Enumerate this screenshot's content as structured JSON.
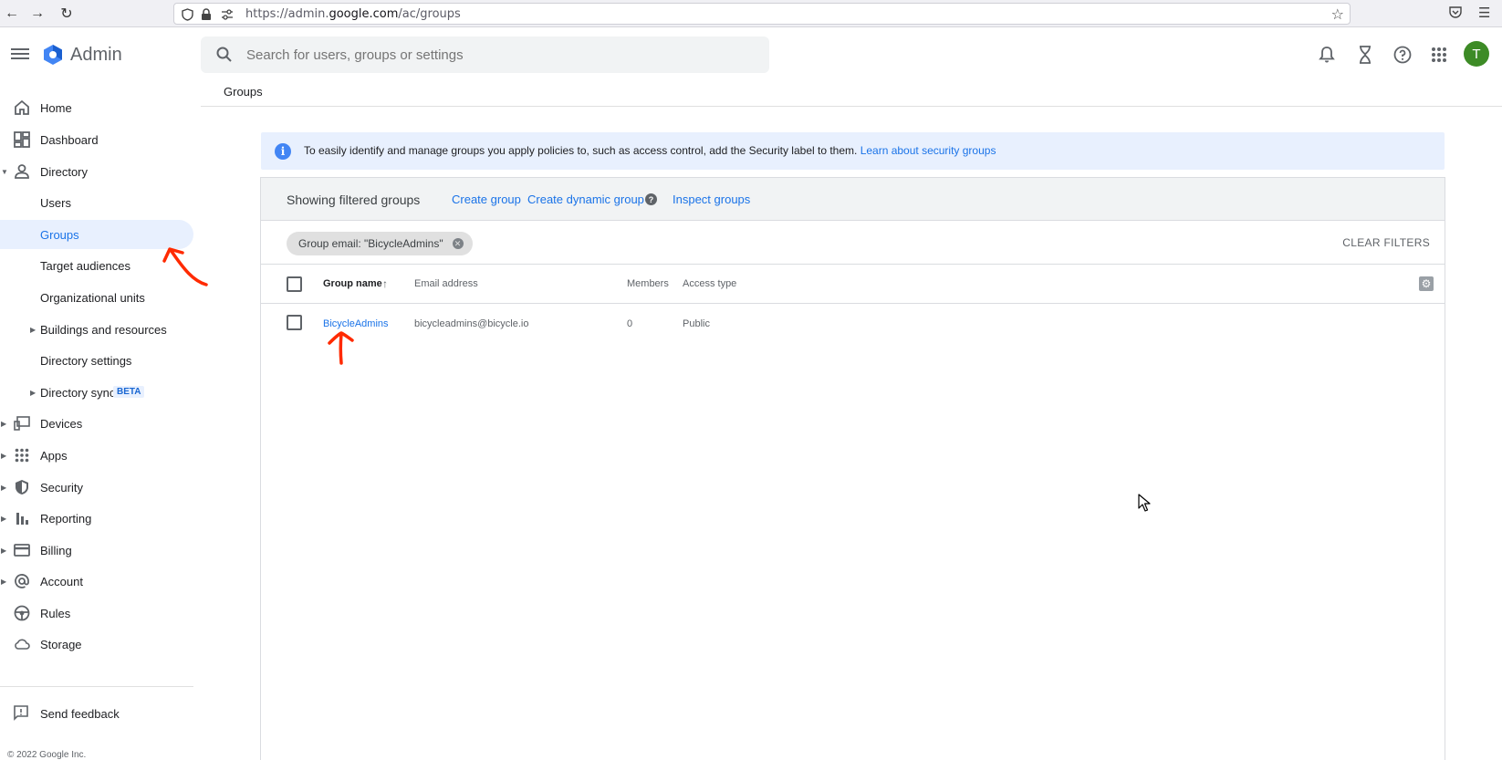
{
  "browser": {
    "url_prefix": "https://admin.",
    "url_domain": "google.com",
    "url_path": "/ac/groups"
  },
  "header": {
    "app_name": "Admin",
    "search_placeholder": "Search for users, groups or settings",
    "avatar_initial": "T",
    "avatar_color": "#3d8b26"
  },
  "breadcrumb": "Groups",
  "sidebar": {
    "items": [
      {
        "label": "Home",
        "icon": "home-icon"
      },
      {
        "label": "Dashboard",
        "icon": "dashboard-icon"
      },
      {
        "label": "Directory",
        "icon": "person-icon",
        "expanded": true
      },
      {
        "label": "Users"
      },
      {
        "label": "Groups",
        "active": true
      },
      {
        "label": "Target audiences"
      },
      {
        "label": "Organizational units"
      },
      {
        "label": "Buildings and resources"
      },
      {
        "label": "Directory settings"
      },
      {
        "label": "Directory sync",
        "badge": "BETA"
      },
      {
        "label": "Devices",
        "icon": "devices-icon"
      },
      {
        "label": "Apps",
        "icon": "apps-grid-icon"
      },
      {
        "label": "Security",
        "icon": "shield-icon"
      },
      {
        "label": "Reporting",
        "icon": "bar-chart-icon"
      },
      {
        "label": "Billing",
        "icon": "credit-card-icon"
      },
      {
        "label": "Account",
        "icon": "at-sign-icon"
      },
      {
        "label": "Rules",
        "icon": "steering-wheel-icon"
      },
      {
        "label": "Storage",
        "icon": "cloud-icon"
      }
    ],
    "feedback": "Send feedback",
    "copyright": "© 2022 Google Inc."
  },
  "banner": {
    "text": "To easily identify and manage groups you apply policies to, such as access control, add the Security label to them. ",
    "link": "Learn about security groups"
  },
  "card": {
    "title": "Showing filtered groups",
    "create_group": "Create group",
    "create_dynamic_group": "Create dynamic group",
    "inspect_groups": "Inspect groups",
    "filter_chip": "Group email: \"BicycleAdmins\"",
    "clear_filters": "CLEAR FILTERS",
    "columns": [
      "Group name",
      "Email address",
      "Members",
      "Access type"
    ],
    "rows": [
      {
        "name": "BicycleAdmins",
        "email": "bicycleadmins@bicycle.io",
        "members": "0",
        "access": "Public"
      }
    ]
  },
  "colors": {
    "accent": "#1a73e8",
    "annotation": "#ff2a00"
  }
}
